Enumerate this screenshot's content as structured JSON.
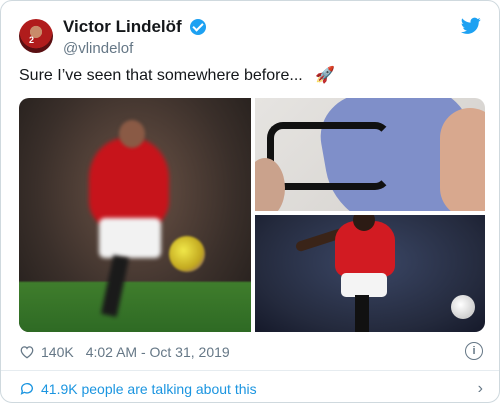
{
  "tweet": {
    "display_name": "Victor Lindelöf",
    "handle": "@vlindelof",
    "text": "Sure I’ve seen that somewhere before...",
    "emoji": "🚀",
    "avatar_badge": "2",
    "likes": "140K",
    "timestamp": "4:02 AM - Oct 31, 2019",
    "talking_about": "41.9K people are talking about this"
  },
  "colors": {
    "twitter_blue": "#1da1f2",
    "text_secondary": "#657786",
    "link_blue": "#1b95e0"
  },
  "icons": {
    "brand": "twitter-bird-icon",
    "verified": "verified-badge-icon",
    "like": "heart-icon",
    "info": "info-icon",
    "comment": "comment-icon",
    "more": "chevron-right-icon"
  }
}
